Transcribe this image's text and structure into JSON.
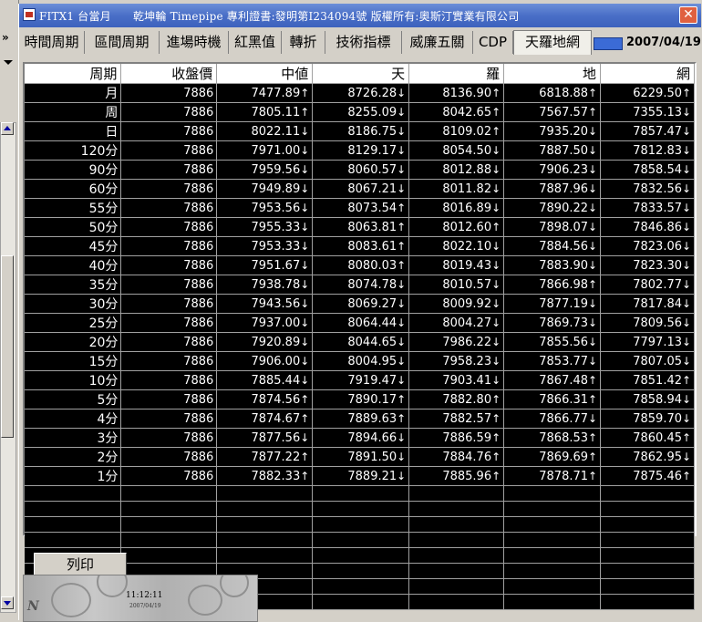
{
  "window": {
    "title": "FITX1 台當月      乾坤輪 Timepipe 專利證書:發明第I234094號 版權所有:奧斯汀實業有限公司",
    "close_label": "✕"
  },
  "left_strip": {
    "chevron": "»"
  },
  "tabs": [
    {
      "label": "時間周期"
    },
    {
      "label": "區間周期"
    },
    {
      "label": "進場時機"
    },
    {
      "label": "紅黑值"
    },
    {
      "label": "轉折"
    },
    {
      "label": "技術指標"
    },
    {
      "label": "威廉五關"
    },
    {
      "label": "CDP"
    },
    {
      "label": "天羅地網",
      "active": true
    }
  ],
  "date": "2007/04/19",
  "grid": {
    "columns": [
      "周期",
      "收盤價",
      "中値",
      "天",
      "羅",
      "地",
      "網"
    ],
    "rows": [
      [
        "月",
        "7886",
        "7477.89",
        "↑",
        "8726.28",
        "↓",
        "8136.90",
        "↑",
        "6818.88",
        "↑",
        "6229.50",
        "↑"
      ],
      [
        "周",
        "7886",
        "7805.11",
        "↑",
        "8255.09",
        "↓",
        "8042.65",
        "↑",
        "7567.57",
        "↑",
        "7355.13",
        "↓"
      ],
      [
        "日",
        "7886",
        "8022.11",
        "↓",
        "8186.75",
        "↓",
        "8109.02",
        "↑",
        "7935.20",
        "↓",
        "7857.47",
        "↓"
      ],
      [
        "120分",
        "7886",
        "7971.00",
        "↓",
        "8129.17",
        "↓",
        "8054.50",
        "↓",
        "7887.50",
        "↓",
        "7812.83",
        "↓"
      ],
      [
        "90分",
        "7886",
        "7959.56",
        "↓",
        "8060.57",
        "↓",
        "8012.88",
        "↓",
        "7906.23",
        "↓",
        "7858.54",
        "↓"
      ],
      [
        "60分",
        "7886",
        "7949.89",
        "↓",
        "8067.21",
        "↓",
        "8011.82",
        "↓",
        "7887.96",
        "↓",
        "7832.56",
        "↓"
      ],
      [
        "55分",
        "7886",
        "7953.56",
        "↓",
        "8073.54",
        "↑",
        "8016.89",
        "↓",
        "7890.22",
        "↓",
        "7833.57",
        "↓"
      ],
      [
        "50分",
        "7886",
        "7955.33",
        "↓",
        "8063.81",
        "↑",
        "8012.60",
        "↑",
        "7898.07",
        "↓",
        "7846.86",
        "↓"
      ],
      [
        "45分",
        "7886",
        "7953.33",
        "↓",
        "8083.61",
        "↑",
        "8022.10",
        "↓",
        "7884.56",
        "↓",
        "7823.06",
        "↓"
      ],
      [
        "40分",
        "7886",
        "7951.67",
        "↓",
        "8080.03",
        "↑",
        "8019.43",
        "↓",
        "7883.90",
        "↓",
        "7823.30",
        "↓"
      ],
      [
        "35分",
        "7886",
        "7938.78",
        "↓",
        "8074.78",
        "↓",
        "8010.57",
        "↓",
        "7866.98",
        "↑",
        "7802.77",
        "↓"
      ],
      [
        "30分",
        "7886",
        "7943.56",
        "↓",
        "8069.27",
        "↓",
        "8009.92",
        "↓",
        "7877.19",
        "↓",
        "7817.84",
        "↓"
      ],
      [
        "25分",
        "7886",
        "7937.00",
        "↓",
        "8064.44",
        "↓",
        "8004.27",
        "↓",
        "7869.73",
        "↓",
        "7809.56",
        "↓"
      ],
      [
        "20分",
        "7886",
        "7920.89",
        "↓",
        "8044.65",
        "↓",
        "7986.22",
        "↓",
        "7855.56",
        "↓",
        "7797.13",
        "↓"
      ],
      [
        "15分",
        "7886",
        "7906.00",
        "↓",
        "8004.95",
        "↓",
        "7958.23",
        "↓",
        "7853.77",
        "↓",
        "7807.05",
        "↓"
      ],
      [
        "10分",
        "7886",
        "7885.44",
        "↓",
        "7919.47",
        "↓",
        "7903.41",
        "↓",
        "7867.48",
        "↑",
        "7851.42",
        "↑"
      ],
      [
        "5分",
        "7886",
        "7874.56",
        "↑",
        "7890.17",
        "↑",
        "7882.80",
        "↑",
        "7866.31",
        "↑",
        "7858.94",
        "↓"
      ],
      [
        "4分",
        "7886",
        "7874.67",
        "↑",
        "7889.63",
        "↑",
        "7882.57",
        "↑",
        "7866.77",
        "↓",
        "7859.70",
        "↓"
      ],
      [
        "3分",
        "7886",
        "7877.56",
        "↓",
        "7894.66",
        "↓",
        "7886.59",
        "↑",
        "7868.53",
        "↑",
        "7860.45",
        "↑"
      ],
      [
        "2分",
        "7886",
        "7877.22",
        "↑",
        "7891.50",
        "↓",
        "7884.76",
        "↑",
        "7869.69",
        "↑",
        "7862.95",
        "↓"
      ],
      [
        "1分",
        "7886",
        "7882.33",
        "↑",
        "7889.21",
        "↓",
        "7885.96",
        "↑",
        "7878.71",
        "↑",
        "7875.46",
        "↑"
      ]
    ],
    "empty_rows": 8
  },
  "print_button": "列印",
  "clock": {
    "time": "11:12:11",
    "date": "2007/04/19",
    "logo": "N"
  }
}
